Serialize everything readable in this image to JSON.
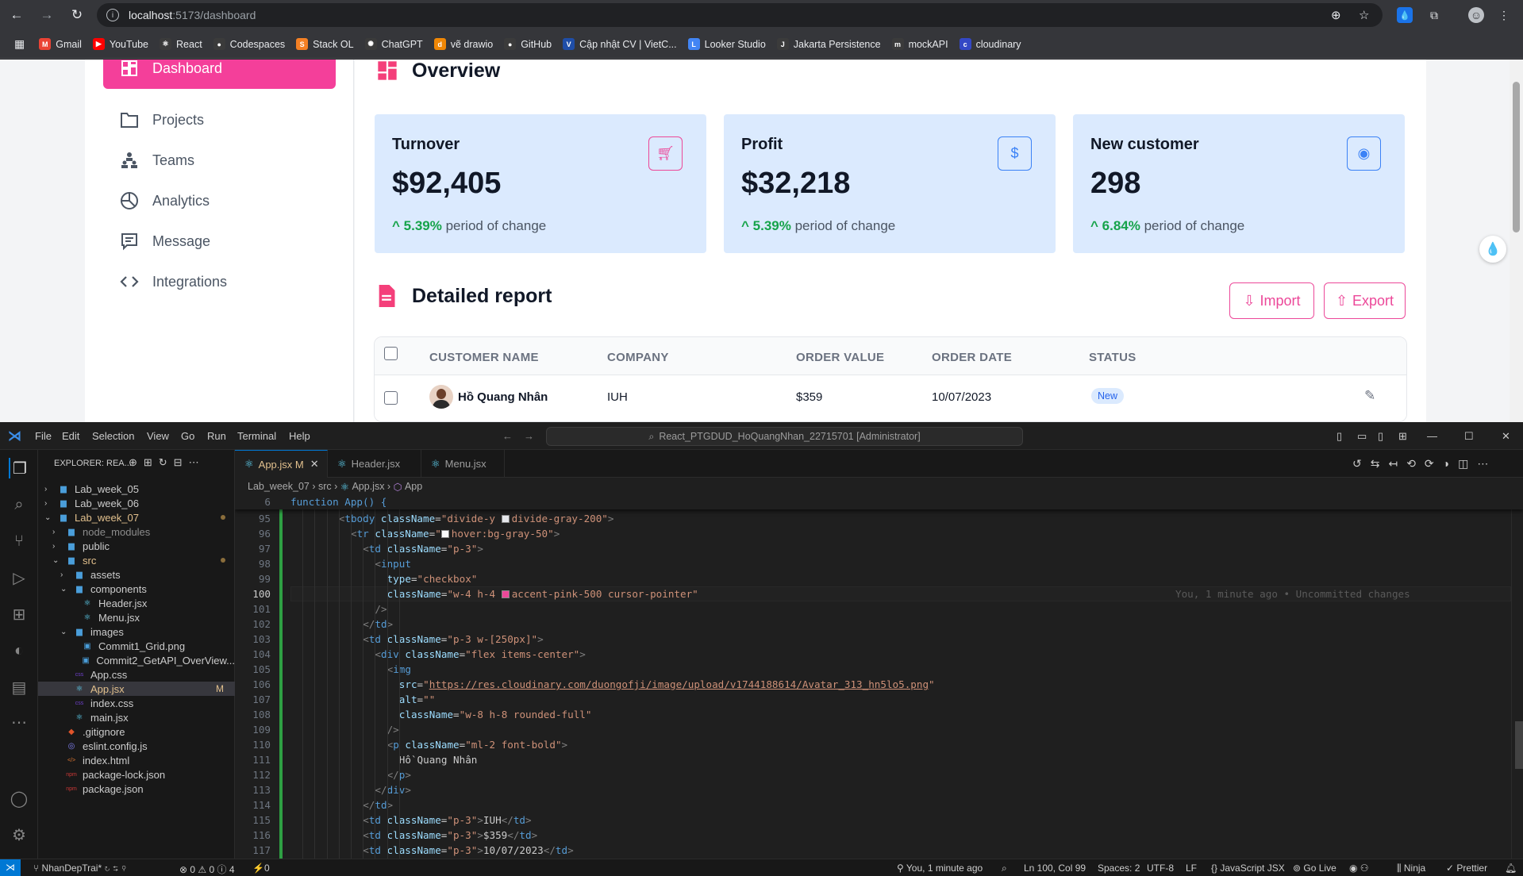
{
  "browser": {
    "url_host": "localhost",
    "url_path": ":5173/dashboard",
    "bookmarks": [
      {
        "label": "Gmail",
        "color": "#ea4335",
        "icon": "M"
      },
      {
        "label": "YouTube",
        "color": "#ff0000",
        "icon": "▶"
      },
      {
        "label": "React",
        "color": "#3b3b3b",
        "icon": "⚛"
      },
      {
        "label": "Codespaces",
        "color": "#3b3b3b",
        "icon": "●"
      },
      {
        "label": "Stack OL",
        "color": "#f48024",
        "icon": "S"
      },
      {
        "label": "ChatGPT",
        "color": "#3b3b3b",
        "icon": "✺"
      },
      {
        "label": "vẽ drawio",
        "color": "#f08705",
        "icon": "d"
      },
      {
        "label": "GitHub",
        "color": "#3b3b3b",
        "icon": "●"
      },
      {
        "label": "Cập nhật CV | VietC...",
        "color": "#1f4ea8",
        "icon": "V"
      },
      {
        "label": "Looker Studio",
        "color": "#4285f4",
        "icon": "L"
      },
      {
        "label": "Jakarta Persistence",
        "color": "#3b3b3b",
        "icon": "J"
      },
      {
        "label": "mockAPI",
        "color": "#3b3b3b",
        "icon": "m"
      },
      {
        "label": "cloudinary",
        "color": "#3448c5",
        "icon": "c"
      }
    ]
  },
  "sidebar": {
    "items": [
      {
        "label": "Dashboard",
        "icon": "dashboard-icon",
        "active": true
      },
      {
        "label": "Projects",
        "icon": "folder-icon"
      },
      {
        "label": "Teams",
        "icon": "teams-icon"
      },
      {
        "label": "Analytics",
        "icon": "pie-chart-icon"
      },
      {
        "label": "Message",
        "icon": "message-icon"
      },
      {
        "label": "Integrations",
        "icon": "code-icon"
      }
    ]
  },
  "overview": {
    "title": "Overview",
    "cards": [
      {
        "title": "Turnover",
        "value": "$92,405",
        "change": "5.39%",
        "change_text": "period of change",
        "icon": "cart-icon",
        "icon_color": "#ec4899"
      },
      {
        "title": "Profit",
        "value": "$32,218",
        "change": "5.39%",
        "change_text": "period of change",
        "icon": "dollar-icon",
        "icon_color": "#3b82f6"
      },
      {
        "title": "New customer",
        "value": "298",
        "change": "6.84%",
        "change_text": "period of change",
        "icon": "user-icon",
        "icon_color": "#3b82f6"
      }
    ]
  },
  "report": {
    "title": "Detailed report",
    "import_label": "Import",
    "export_label": "Export",
    "columns": [
      "CUSTOMER NAME",
      "COMPANY",
      "ORDER VALUE",
      "ORDER DATE",
      "STATUS"
    ],
    "rows": [
      {
        "name": "Hồ Quang Nhân",
        "company": "IUH",
        "value": "$359",
        "date": "10/07/2023",
        "status": "New"
      }
    ]
  },
  "vscode": {
    "menus": [
      "File",
      "Edit",
      "Selection",
      "View",
      "Go",
      "Run",
      "Terminal",
      "Help"
    ],
    "search": "React_PTGDUD_HoQuangNhan_22715701 [Administrator]",
    "explorer_title": "EXPLORER: REA...",
    "tree": [
      {
        "label": "Lab_week_05",
        "depth": 0,
        "type": "folder"
      },
      {
        "label": "Lab_week_06",
        "depth": 0,
        "type": "folder"
      },
      {
        "label": "Lab_week_07",
        "depth": 0,
        "type": "folder-open",
        "modified": true
      },
      {
        "label": "node_modules",
        "depth": 1,
        "type": "folder",
        "dim": true
      },
      {
        "label": "public",
        "depth": 1,
        "type": "folder"
      },
      {
        "label": "src",
        "depth": 1,
        "type": "folder-open",
        "modified": true
      },
      {
        "label": "assets",
        "depth": 2,
        "type": "folder"
      },
      {
        "label": "components",
        "depth": 2,
        "type": "folder-open"
      },
      {
        "label": "Header.jsx",
        "depth": 3,
        "type": "react"
      },
      {
        "label": "Menu.jsx",
        "depth": 3,
        "type": "react"
      },
      {
        "label": "images",
        "depth": 2,
        "type": "folder-open"
      },
      {
        "label": "Commit1_Grid.png",
        "depth": 3,
        "type": "image"
      },
      {
        "label": "Commit2_GetAPI_OverView...",
        "depth": 3,
        "type": "image"
      },
      {
        "label": "App.css",
        "depth": 2,
        "type": "css"
      },
      {
        "label": "App.jsx",
        "depth": 2,
        "type": "react",
        "active": true,
        "badge": "M"
      },
      {
        "label": "index.css",
        "depth": 2,
        "type": "css"
      },
      {
        "label": "main.jsx",
        "depth": 2,
        "type": "react"
      },
      {
        "label": ".gitignore",
        "depth": 1,
        "type": "git"
      },
      {
        "label": "eslint.config.js",
        "depth": 1,
        "type": "eslint"
      },
      {
        "label": "index.html",
        "depth": 1,
        "type": "html"
      },
      {
        "label": "package-lock.json",
        "depth": 1,
        "type": "npm"
      },
      {
        "label": "package.json",
        "depth": 1,
        "type": "npm"
      }
    ],
    "tabs": [
      {
        "label": "App.jsx",
        "badge": "M",
        "active": true
      },
      {
        "label": "Header.jsx"
      },
      {
        "label": "Menu.jsx"
      }
    ],
    "breadcrumb": [
      "Lab_week_07",
      "src",
      "App.jsx",
      "App"
    ],
    "sticky_line": {
      "num": "6",
      "text": "function App() {"
    },
    "lines": [
      {
        "num": "95",
        "html": "<span class='pn'>&lt;</span><span class='tg'>tbody</span> <span class='at'>className</span>=<span class='st'>\"divide-y <span class='sw' style='background:#e5e7eb'></span>divide-gray-200\"</span><span class='pn'>&gt;</span>",
        "indent": 8
      },
      {
        "num": "96",
        "html": "<span class='pn'>&lt;</span><span class='tg'>tr</span> <span class='at'>className</span>=<span class='st'>\"<span class='sw' style='background:#f9fafb'></span>hover:bg-gray-50\"</span><span class='pn'>&gt;</span>",
        "indent": 10
      },
      {
        "num": "97",
        "html": "<span class='pn'>&lt;</span><span class='tg'>td</span> <span class='at'>className</span>=<span class='st'>\"p-3\"</span><span class='pn'>&gt;</span>",
        "indent": 12
      },
      {
        "num": "98",
        "html": "<span class='pn'>&lt;</span><span class='tg'>input</span>",
        "indent": 14
      },
      {
        "num": "99",
        "html": "<span class='at'>type</span>=<span class='st'>\"checkbox\"</span>",
        "indent": 16
      },
      {
        "num": "100",
        "html": "<span class='at'>className</span>=<span class='st'>\"w-4 h-4 <span class='sw' style='background:#ec4899'></span>accent-pink-500 cursor-pointer\"</span>",
        "indent": 16,
        "current": true,
        "blame": "You, 1 minute ago • Uncommitted changes"
      },
      {
        "num": "101",
        "html": "<span class='pn'>/&gt;</span>",
        "indent": 14
      },
      {
        "num": "102",
        "html": "<span class='pn'>&lt;/</span><span class='tg'>td</span><span class='pn'>&gt;</span>",
        "indent": 12
      },
      {
        "num": "103",
        "html": "<span class='pn'>&lt;</span><span class='tg'>td</span> <span class='at'>className</span>=<span class='st'>\"p-3 w-[250px]\"</span><span class='pn'>&gt;</span>",
        "indent": 12
      },
      {
        "num": "104",
        "html": "<span class='pn'>&lt;</span><span class='tg'>div</span> <span class='at'>className</span>=<span class='st'>\"flex items-center\"</span><span class='pn'>&gt;</span>",
        "indent": 14
      },
      {
        "num": "105",
        "html": "<span class='pn'>&lt;</span><span class='tg'>img</span>",
        "indent": 16
      },
      {
        "num": "106",
        "html": "<span class='at'>src</span>=<span class='st'>\"</span><span class='url'>https://res.cloudinary.com/duongofji/image/upload/v1744188614/Avatar_313_hn5lo5.png</span><span class='st'>\"</span>",
        "indent": 18
      },
      {
        "num": "107",
        "html": "<span class='at'>alt</span>=<span class='st'>\"\"</span>",
        "indent": 18
      },
      {
        "num": "108",
        "html": "<span class='at'>className</span>=<span class='st'>\"w-8 h-8 rounded-full\"</span>",
        "indent": 18
      },
      {
        "num": "109",
        "html": "<span class='pn'>/&gt;</span>",
        "indent": 16
      },
      {
        "num": "110",
        "html": "<span class='pn'>&lt;</span><span class='tg'>p</span> <span class='at'>className</span>=<span class='st'>\"ml-2 font-bold\"</span><span class='pn'>&gt;</span>",
        "indent": 16
      },
      {
        "num": "111",
        "html": "Hồ Quang Nhân",
        "indent": 18
      },
      {
        "num": "112",
        "html": "<span class='pn'>&lt;/</span><span class='tg'>p</span><span class='pn'>&gt;</span>",
        "indent": 16
      },
      {
        "num": "113",
        "html": "<span class='pn'>&lt;/</span><span class='tg'>div</span><span class='pn'>&gt;</span>",
        "indent": 14
      },
      {
        "num": "114",
        "html": "<span class='pn'>&lt;/</span><span class='tg'>td</span><span class='pn'>&gt;</span>",
        "indent": 12
      },
      {
        "num": "115",
        "html": "<span class='pn'>&lt;</span><span class='tg'>td</span> <span class='at'>className</span>=<span class='st'>\"p-3\"</span><span class='pn'>&gt;</span>IUH<span class='pn'>&lt;/</span><span class='tg'>td</span><span class='pn'>&gt;</span>",
        "indent": 12
      },
      {
        "num": "116",
        "html": "<span class='pn'>&lt;</span><span class='tg'>td</span> <span class='at'>className</span>=<span class='st'>\"p-3\"</span><span class='pn'>&gt;</span>$359<span class='pn'>&lt;/</span><span class='tg'>td</span><span class='pn'>&gt;</span>",
        "indent": 12
      },
      {
        "num": "117",
        "html": "<span class='pn'>&lt;</span><span class='tg'>td</span> <span class='at'>className</span>=<span class='st'>\"p-3\"</span><span class='pn'>&gt;</span>10/07/2023<span class='pn'>&lt;/</span><span class='tg'>td</span><span class='pn'>&gt;</span>",
        "indent": 12
      }
    ],
    "status": {
      "branch": "NhanDepTrai*",
      "problems": "⊗ 0 ⚠ 0 ⓘ 4",
      "ports": "0",
      "blame": "You, 1 minute ago",
      "position": "Ln 100, Col 99",
      "spaces": "Spaces: 2",
      "encoding": "UTF-8",
      "eol": "LF",
      "language": "JavaScript JSX",
      "golive": "Go Live",
      "ninja": "Ninja",
      "prettier": "Prettier"
    }
  }
}
